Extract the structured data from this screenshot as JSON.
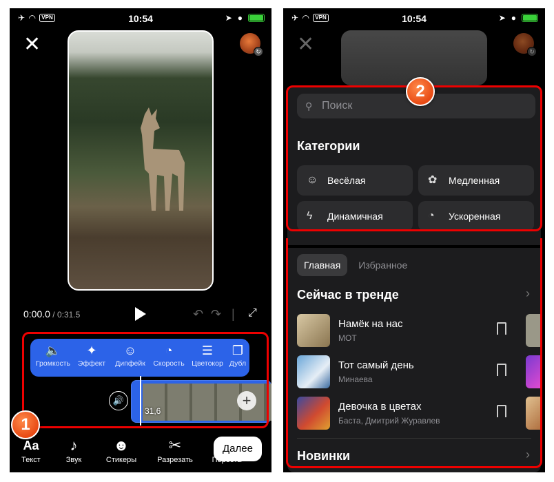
{
  "left": {
    "status": {
      "time": "10:54",
      "vpn": "VPN"
    },
    "playback": {
      "current": "0:00",
      "current_frac": ".0",
      "total": " / 0:31.5"
    },
    "tools": [
      {
        "label": "Громкость",
        "icon": "volume-icon"
      },
      {
        "label": "Эффект",
        "icon": "sparkle-icon"
      },
      {
        "label": "Дипфейк",
        "icon": "face-swap-icon"
      },
      {
        "label": "Скорость",
        "icon": "speedometer-icon"
      },
      {
        "label": "Цветокор",
        "icon": "sliders-icon"
      },
      {
        "label": "Дубл",
        "icon": "duplicate-icon"
      }
    ],
    "timeline_seconds": "31,6",
    "nav": [
      {
        "label": "Текст",
        "icon": "text-icon"
      },
      {
        "label": "Звук",
        "icon": "music-note-icon"
      },
      {
        "label": "Стикеры",
        "icon": "sticker-icon"
      },
      {
        "label": "Разрезать",
        "icon": "scissors-icon"
      },
      {
        "label": "Переста",
        "icon": "rearrange-icon"
      }
    ],
    "next_label": "Далее",
    "badge": "1"
  },
  "right": {
    "status": {
      "time": "10:54",
      "vpn": "VPN"
    },
    "badge": "2",
    "search_placeholder": "Поиск",
    "categories_title": "Категории",
    "categories": [
      {
        "label": "Весёлая",
        "icon": "smile-icon"
      },
      {
        "label": "Медленная",
        "icon": "lotus-icon"
      },
      {
        "label": "Динамичная",
        "icon": "lightning-icon"
      },
      {
        "label": "Ускоренная",
        "icon": "speedometer-icon"
      }
    ],
    "tabs": [
      "Главная",
      "Избранное"
    ],
    "trending_title": "Сейчас в тренде",
    "tracks": [
      {
        "title": "Намёк на нас",
        "artist": "МОТ"
      },
      {
        "title": "Тот самый день",
        "artist": "Минаева"
      },
      {
        "title": "Девочка в цветах",
        "artist": "Баста, Дмитрий Журавлев"
      }
    ],
    "new_title": "Новинки"
  },
  "colors": {
    "accent": "#2c63e8",
    "highlight": "#e00000",
    "badge": "#e84a14",
    "sheet": "#1c1c1e"
  }
}
